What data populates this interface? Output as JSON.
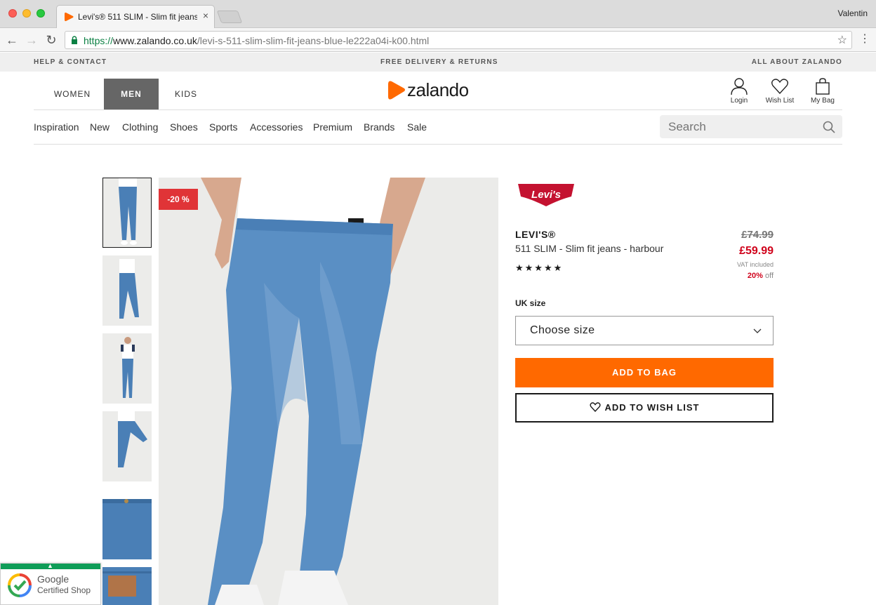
{
  "browser": {
    "tab_title": "Levi's® 511 SLIM - Slim fit jeans",
    "tab_close": "×",
    "profile": "Valentin",
    "url_scheme": "https://",
    "url_host": "www.zalando.co.uk",
    "url_path": "/levi-s-511-slim-slim-fit-jeans-blue-le222a04i-k00.html"
  },
  "service_bar": {
    "left": "HELP & CONTACT",
    "center": "FREE DELIVERY & RETURNS",
    "right": "ALL ABOUT ZALANDO"
  },
  "header": {
    "genders": [
      "WOMEN",
      "MEN",
      "KIDS"
    ],
    "active_gender": "MEN",
    "logo_text": "zalando",
    "icons": [
      {
        "label": "Login",
        "icon": "user-icon"
      },
      {
        "label": "Wish List",
        "icon": "heart-icon"
      },
      {
        "label": "My Bag",
        "icon": "bag-icon"
      }
    ]
  },
  "categories": [
    "Inspiration",
    "New",
    "Clothing",
    "Shoes",
    "Sports",
    "Accessories",
    "Premium",
    "Brands",
    "Sale"
  ],
  "search": {
    "placeholder": "Search"
  },
  "product": {
    "badge": "-20 %",
    "brand_logo_text": "Levi's",
    "brand": "LEVI'S®",
    "name": "511 SLIM - Slim fit jeans - harbour",
    "rating_stars": "★★★★★",
    "old_price": "£74.99",
    "price": "£59.99",
    "vat": "VAT included",
    "discount_pct": "20%",
    "discount_suffix": "off",
    "size_label": "UK size",
    "size_placeholder": "Choose size",
    "add_to_bag": "ADD TO BAG",
    "add_to_wishlist": "ADD TO WISH LIST"
  },
  "google_badge": {
    "line1": "Google",
    "line2": "Certified Shop"
  },
  "colors": {
    "accent": "#ff6900",
    "sale_red": "#d0021b",
    "badge_red": "#e03437"
  }
}
